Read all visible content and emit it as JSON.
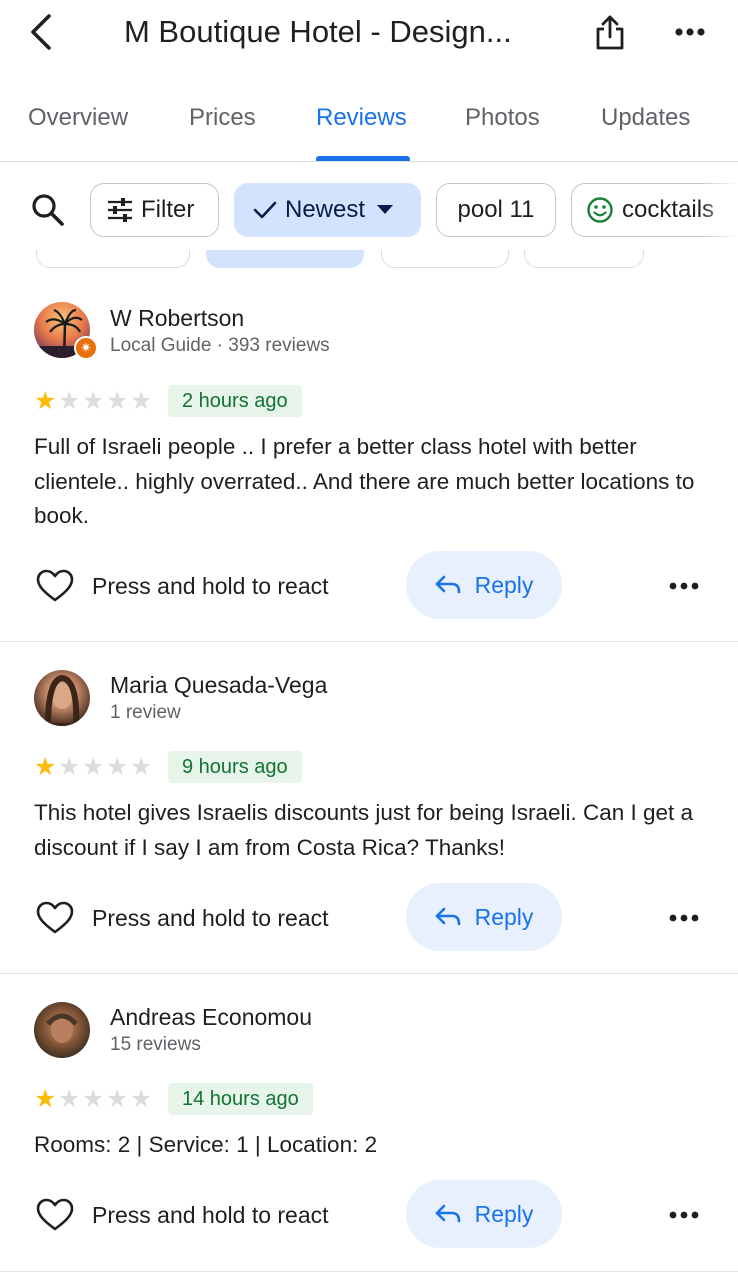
{
  "header": {
    "title": "M Boutique Hotel - Design...",
    "back_icon": "back-arrow-icon",
    "share_icon": "share-icon",
    "more_icon": "more-horizontal-icon"
  },
  "tabs": [
    {
      "label": "Overview"
    },
    {
      "label": "Prices"
    },
    {
      "label": "Reviews",
      "active": true
    },
    {
      "label": "Photos"
    },
    {
      "label": "Updates"
    }
  ],
  "filters": {
    "filter_label": "Filter",
    "sort_label": "Newest",
    "topic1_label": "pool 11",
    "topic2_label": "cocktails"
  },
  "reviews": [
    {
      "name": "W Robertson",
      "subtitle": "Local Guide · 393 reviews",
      "rating": 1,
      "time": "2 hours ago",
      "text": "Full of Israeli people .. I prefer a better class hotel with better clientele.. highly overrated.. And there are much better locations to book.",
      "react_label": "Press and hold to react",
      "reply_label": "Reply"
    },
    {
      "name": "Maria Quesada-Vega",
      "subtitle": "1 review",
      "rating": 1,
      "time": "9 hours ago",
      "text": "This hotel gives Israelis discounts just for being Israeli. Can I get a discount if I say I am from Costa Rica? Thanks!",
      "react_label": "Press and hold to react",
      "reply_label": "Reply"
    },
    {
      "name": "Andreas Economou",
      "subtitle": "15 reviews",
      "rating": 1,
      "time": "14 hours ago",
      "text": "Rooms: 2 | Service: 1 | Location: 2",
      "react_label": "Press and hold to react",
      "reply_label": "Reply"
    }
  ],
  "colors": {
    "accent": "#1a73e8",
    "star": "#fbbc04",
    "time_badge_bg": "#e6f4ea",
    "time_badge_text": "#137333"
  }
}
